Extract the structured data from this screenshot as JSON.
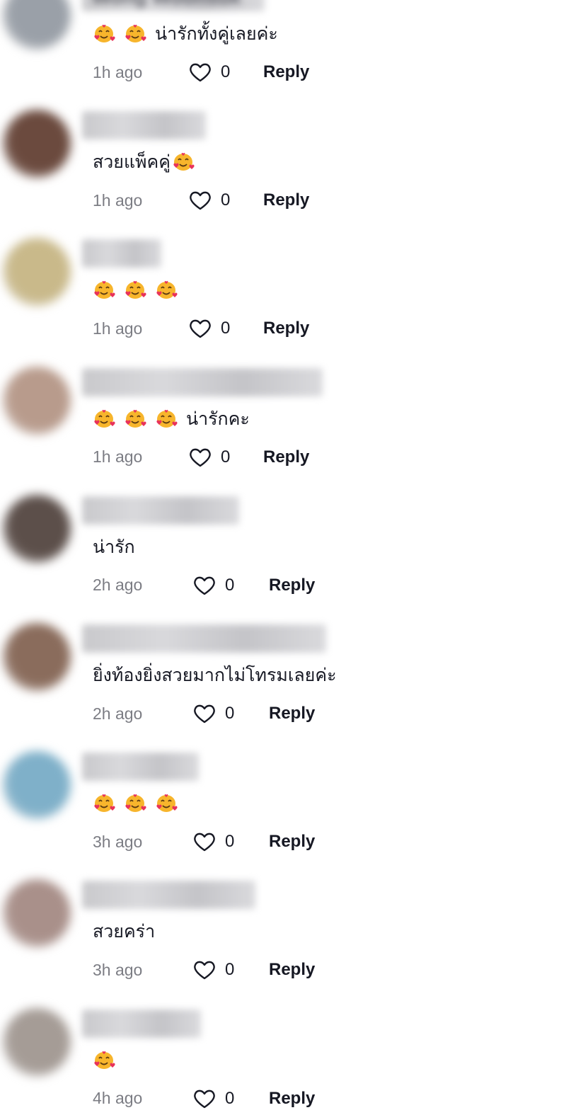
{
  "comments": [
    {
      "text": "น่ารักทั้งคู่เลยค่ะ",
      "emojis": 2,
      "time": "1h ago",
      "likes": "0",
      "reply": "Reply",
      "avatar_color": "#9aa0a8",
      "name_width": 258,
      "name_hint": "Wong Woonsuk"
    },
    {
      "text": "สวยแพ็คคู่",
      "emojis_after": 1,
      "emojis": 0,
      "time": "1h ago",
      "likes": "0",
      "reply": "Reply",
      "avatar_color": "#6b4a3e",
      "name_width": 175,
      "name_hint": ""
    },
    {
      "text": "",
      "emojis": 3,
      "time": "1h ago",
      "likes": "0",
      "reply": "Reply",
      "avatar_color": "#c9b98a",
      "name_width": 112,
      "name_hint": ""
    },
    {
      "text": "น่ารักคะ",
      "emojis": 3,
      "time": "1h ago",
      "likes": "0",
      "reply": "Reply",
      "avatar_color": "#b89b8c",
      "name_width": 340,
      "name_hint": ""
    },
    {
      "text": "น่ารัก",
      "emojis": 0,
      "time": "2h ago",
      "likes": "0",
      "reply": "Reply",
      "avatar_color": "#5c4f4a",
      "name_width": 222,
      "name_hint": ""
    },
    {
      "text": "ยิ่งท้องยิ่งสวยมากไม่โทรมเลยค่ะ",
      "emojis": 0,
      "time": "2h ago",
      "likes": "0",
      "reply": "Reply",
      "avatar_color": "#8a6c5c",
      "name_width": 345,
      "name_hint": ""
    },
    {
      "text": "",
      "emojis": 3,
      "time": "3h ago",
      "likes": "0",
      "reply": "Reply",
      "avatar_color": "#7fb0c9",
      "name_width": 165,
      "name_hint": ""
    },
    {
      "text": "สวยคร่า",
      "emojis": 0,
      "time": "3h ago",
      "likes": "0",
      "reply": "Reply",
      "avatar_color": "#a9908a",
      "name_width": 245,
      "name_hint": ""
    },
    {
      "text": "",
      "emojis": 1,
      "time": "4h ago",
      "likes": "0",
      "reply": "Reply",
      "avatar_color": "#a59c96",
      "name_width": 168,
      "name_hint": ""
    }
  ],
  "icons": {
    "heart": "heart-outline-icon",
    "emoji": "smiling-face-with-hearts-emoji"
  }
}
